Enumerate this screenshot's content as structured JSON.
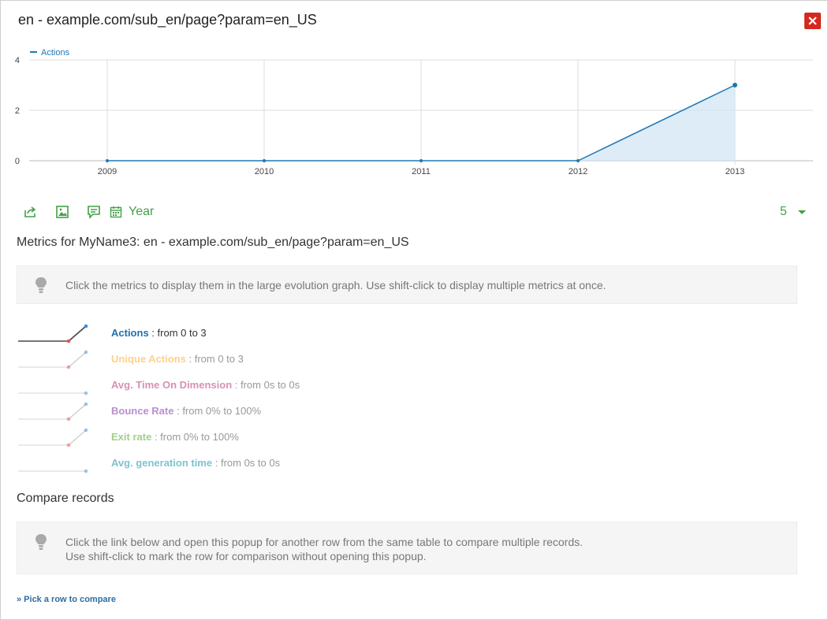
{
  "title": "en - example.com/sub_en/page?param=en_US",
  "chart_data": {
    "type": "line",
    "legend": "Actions",
    "x": [
      "2009",
      "2010",
      "2011",
      "2012",
      "2013"
    ],
    "series": [
      {
        "name": "Actions",
        "values": [
          0,
          0,
          0,
          0,
          3
        ]
      }
    ],
    "y_ticks": [
      "0",
      "2",
      "4"
    ],
    "ylim": [
      0,
      4
    ],
    "grid": true,
    "colors": {
      "line": "#1f78b4",
      "fill": "#cfe4f3"
    }
  },
  "toolbar": {
    "period": "Year",
    "limit": "5"
  },
  "metrics_section": {
    "title": "Metrics for MyName3: en - example.com/sub_en/page?param=en_US",
    "hint": "Click the metrics to display them in the large evolution graph. Use shift-click to display multiple metrics at once."
  },
  "metrics": [
    {
      "name": "Actions",
      "range": ": from 0 to 3",
      "color": "#1f6fab",
      "trend": "up"
    },
    {
      "name": "Unique Actions",
      "range": ": from 0 to 3",
      "color": "#ffd08a",
      "trend": "up"
    },
    {
      "name": "Avg. Time On Dimension",
      "range": ": from 0s to 0s",
      "color": "#d890b4",
      "trend": "flat"
    },
    {
      "name": "Bounce Rate",
      "range": ": from 0% to 100%",
      "color": "#b88fce",
      "trend": "up"
    },
    {
      "name": "Exit rate",
      "range": ": from 0% to 100%",
      "color": "#a2cf8c",
      "trend": "up"
    },
    {
      "name": "Avg. generation time",
      "range": ": from 0s to 0s",
      "color": "#7ec2d2",
      "trend": "flat"
    }
  ],
  "compare": {
    "title": "Compare records",
    "hint_line1": "Click the link below and open this popup for another row from the same table to compare multiple records.",
    "hint_line2": "Use shift-click to mark the row for comparison without opening this popup.",
    "link": "» Pick a row to compare"
  }
}
